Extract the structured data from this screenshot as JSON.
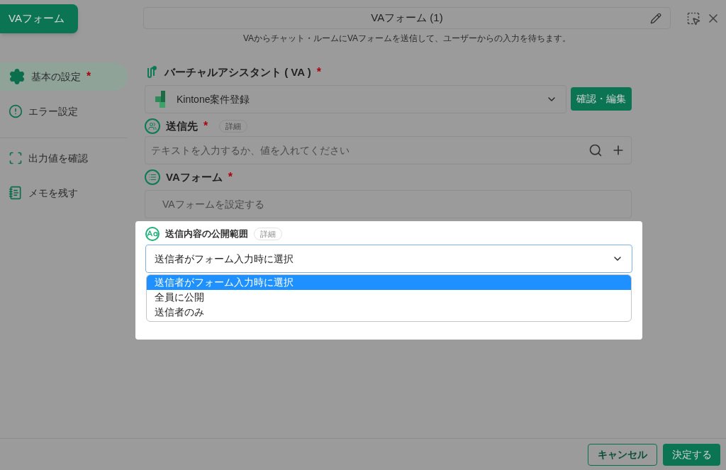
{
  "tab_label": "VAフォーム",
  "header": {
    "title": "VAフォーム (1)",
    "description": "VAからチャット・ルームにVAフォームを送信して、ユーザーからの入力を待ちます。"
  },
  "sidebar": {
    "items": [
      {
        "kind": "gear",
        "label": "基本の設定",
        "required_mark": "*",
        "selected": true
      },
      {
        "kind": "alert",
        "label": "エラー設定",
        "selected": false
      },
      {
        "kind": "scan",
        "label": "出力値を確認",
        "selected": false
      },
      {
        "kind": "memo",
        "label": "メモを残す",
        "selected": false
      }
    ]
  },
  "virtual_assistant": {
    "label": "バーチャルアシスタント ( VA )",
    "required_mark": "*",
    "value": "Kintone案件登録",
    "button": "確認・編集"
  },
  "recipient": {
    "label": "送信先",
    "required_mark": "*",
    "detail": "詳細",
    "placeholder": "テキストを入力するか、値を入れてください"
  },
  "va_form": {
    "label": "VAフォーム",
    "required_mark": "*",
    "placeholder": "VAフォームを設定する"
  },
  "visibility": {
    "label": "送信内容の公開範囲",
    "detail": "詳細",
    "value": "送信者がフォーム入力時に選択",
    "expanded": true,
    "options": [
      {
        "label": "送信者がフォーム入力時に選択",
        "selected": true
      },
      {
        "label": "全員に公開",
        "selected": false
      },
      {
        "label": "送信者のみ",
        "selected": false
      }
    ]
  },
  "footer": {
    "cancel": "キャンセル",
    "confirm": "決定する"
  }
}
